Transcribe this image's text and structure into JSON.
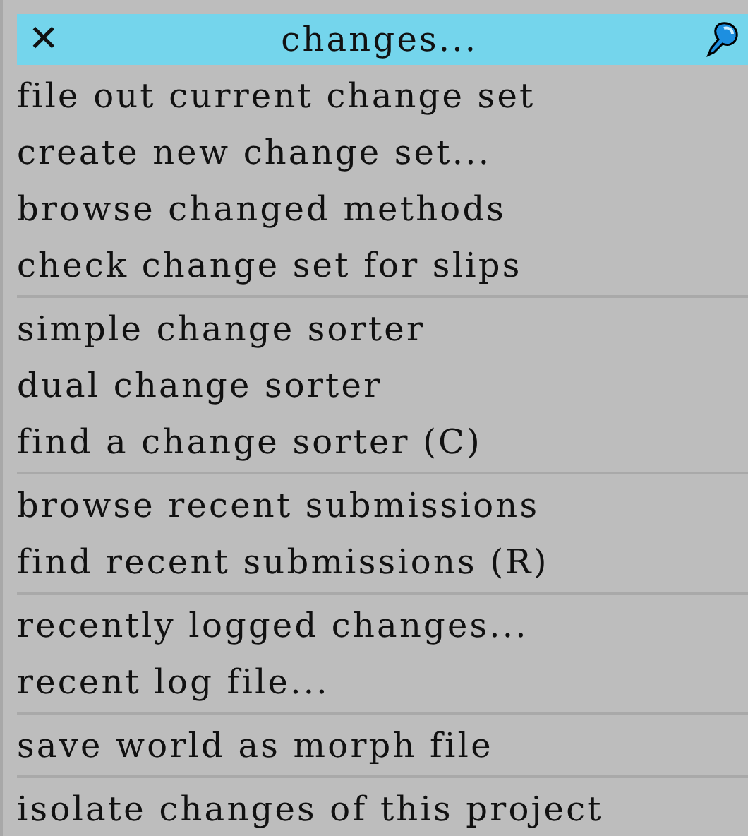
{
  "menu": {
    "title": "changes...",
    "close_glyph": "✕",
    "groups": [
      [
        "file out current change set",
        "create new change set...",
        "browse changed methods",
        "check change set for slips"
      ],
      [
        "simple change sorter",
        "dual change sorter",
        "find a change sorter (C)"
      ],
      [
        "browse recent submissions",
        "find recent submissions (R)"
      ],
      [
        "recently logged changes...",
        "recent log file..."
      ],
      [
        "save world as morph file"
      ],
      [
        "isolate changes of this project"
      ]
    ]
  }
}
